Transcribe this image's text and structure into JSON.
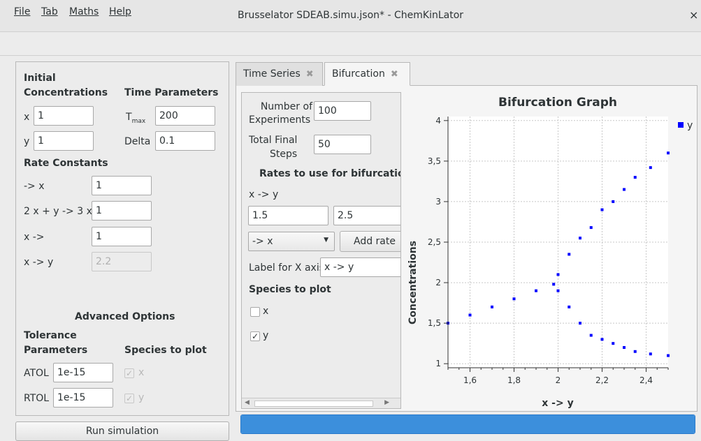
{
  "window": {
    "title": "Brusselator SDEAB.simu.json* - ChemKinLator",
    "close": "×"
  },
  "menu": {
    "file": "File",
    "tab": "Tab",
    "maths": "Maths",
    "help": "Help"
  },
  "left": {
    "initial_conc_line1": "Initial",
    "initial_conc_line2": "Concentrations",
    "time_params": "Time Parameters",
    "x_label": "x",
    "x_value": "1",
    "y_label": "y",
    "y_value": "1",
    "tmax_label": "T",
    "tmax_sub": "max",
    "tmax_value": "200",
    "delta_label": "Delta",
    "delta_value": "0.1",
    "rate_constants": "Rate Constants",
    "rates": [
      {
        "label": "-> x",
        "value": "1"
      },
      {
        "label": "2 x + y -> 3 x",
        "value": "1"
      },
      {
        "label": "x ->",
        "value": "1"
      },
      {
        "label": "x -> y",
        "value": "2.2"
      }
    ],
    "advanced": "Advanced Options",
    "tol_line1": "Tolerance",
    "tol_line2": "Parameters",
    "species_to_plot": "Species to plot",
    "atol_label": "ATOL",
    "atol_value": "1e-15",
    "rtol_label": "RTOL",
    "rtol_value": "1e-15",
    "sp_x": "x",
    "sp_y": "y",
    "run": "Run simulation"
  },
  "tabs": [
    {
      "label": "Time Series",
      "close": "✖"
    },
    {
      "label": "Bifurcation",
      "close": "✖"
    }
  ],
  "bif": {
    "num_exp_line1": "Number of",
    "num_exp_line2": "Experiments",
    "num_exp_value": "100",
    "tfs_line1": "Total Final",
    "tfs_line2": "Steps",
    "tfs_value": "50",
    "rates_heading": "Rates to use for bifurcation",
    "rate_name": "x -> y",
    "from_value": "1.5",
    "to_value": "2.5",
    "combo_value": "-> x",
    "add_rate": "Add rate",
    "label_x_axis": "Label for X axis",
    "label_x_value": "x -> y",
    "species_heading": "Species to plot",
    "sp_x": "x",
    "sp_y": "y"
  },
  "chart_data": {
    "type": "scatter",
    "title": "Bifurcation Graph",
    "xlabel": "x -> y",
    "ylabel": "Concentrations",
    "xlim": [
      1.5,
      2.5
    ],
    "ylim": [
      0.95,
      4.05
    ],
    "xticks": [
      "1,6",
      "1,8",
      "2",
      "2,2",
      "2,4"
    ],
    "xtick_values": [
      1.6,
      1.8,
      2.0,
      2.2,
      2.4
    ],
    "yticks": [
      "1",
      "1,5",
      "2",
      "2,5",
      "3",
      "3,5",
      "4"
    ],
    "ytick_values": [
      1,
      1.5,
      2,
      2.5,
      3,
      3.5,
      4
    ],
    "grid": true,
    "legend": "top-right",
    "series": [
      {
        "name": "y",
        "color": "#0000ff"
      }
    ],
    "points": [
      [
        1.5,
        1.5
      ],
      [
        1.6,
        1.6
      ],
      [
        1.7,
        1.7
      ],
      [
        1.8,
        1.8
      ],
      [
        1.9,
        1.9
      ],
      [
        1.98,
        1.98
      ],
      [
        2.0,
        2.1
      ],
      [
        2.0,
        1.9
      ],
      [
        2.05,
        2.35
      ],
      [
        2.05,
        1.7
      ],
      [
        2.1,
        2.55
      ],
      [
        2.1,
        1.5
      ],
      [
        2.15,
        2.68
      ],
      [
        2.15,
        1.35
      ],
      [
        2.2,
        2.9
      ],
      [
        2.2,
        1.3
      ],
      [
        2.25,
        3.0
      ],
      [
        2.25,
        1.25
      ],
      [
        2.3,
        3.15
      ],
      [
        2.3,
        1.2
      ],
      [
        2.35,
        3.3
      ],
      [
        2.35,
        1.15
      ],
      [
        2.42,
        3.42
      ],
      [
        2.42,
        1.12
      ],
      [
        2.5,
        3.6
      ],
      [
        2.5,
        1.1
      ]
    ]
  },
  "progress": {
    "value": 1.0,
    "color": "#3c8fdc"
  }
}
